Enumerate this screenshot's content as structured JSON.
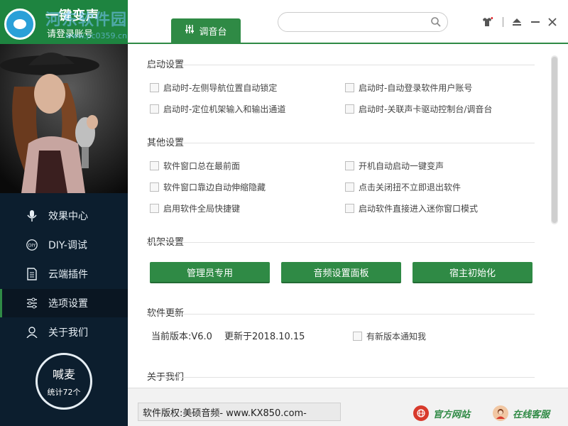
{
  "app": {
    "title": "一键变声",
    "login": "请登录账号",
    "watermark": "河东软件园",
    "watermark_url": "www.pc0359.cn"
  },
  "toolbar": {
    "mixer_tab": "调音台",
    "search_placeholder": ""
  },
  "sidebar": {
    "items": [
      {
        "label": "效果中心",
        "icon": "microphone-icon"
      },
      {
        "label": "DIY-调试",
        "icon": "diy-icon"
      },
      {
        "label": "云端插件",
        "icon": "document-icon"
      },
      {
        "label": "选项设置",
        "icon": "sliders-icon"
      },
      {
        "label": "关于我们",
        "icon": "user-icon"
      }
    ],
    "mic_title": "喊麦",
    "mic_count": "统计72个"
  },
  "sections": {
    "startup": {
      "title": "启动设置",
      "options": [
        "启动时-左侧导航位置自动锁定",
        "启动时-自动登录软件用户账号",
        "启动时-定位机架输入和输出通道",
        "启动时-关联声卡驱动控制台/调音台"
      ]
    },
    "other": {
      "title": "其他设置",
      "options": [
        "软件窗口总在最前面",
        "开机自动启动一键变声",
        "软件窗口靠边自动伸缩隐藏",
        "点击关闭扭不立即退出软件",
        "启用软件全局快捷键",
        "启动软件直接进入迷你窗口模式"
      ]
    },
    "rack": {
      "title": "机架设置",
      "buttons": [
        "管理员专用",
        "音频设置面板",
        "宿主初始化"
      ]
    },
    "update": {
      "title": "软件更新",
      "version": "当前版本:V6.0",
      "updated": "更新于2018.10.15",
      "notify": "有新版本通知我"
    },
    "about": {
      "title": "关于我们"
    }
  },
  "footer": {
    "copyright": "软件版权:美硕音频- www.KX850.com-",
    "website": "官方网站",
    "support": "在线客服"
  },
  "colors": {
    "accent": "#2f8a45",
    "sidebar": "#0c1e2e"
  }
}
